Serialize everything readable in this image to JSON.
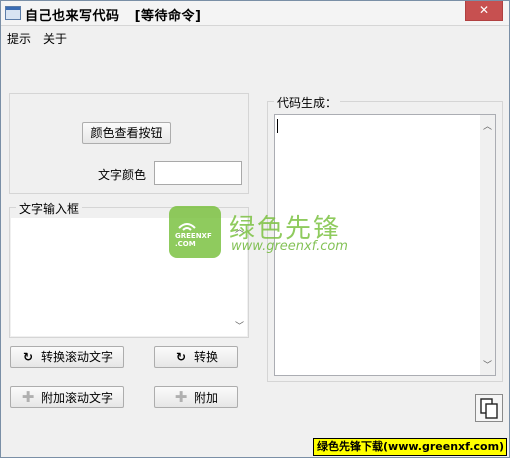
{
  "window": {
    "title": "自己也来写代码   [等待命令]",
    "close_label": "✕"
  },
  "menu": {
    "items": [
      "提示",
      "关于"
    ]
  },
  "color_panel": {
    "view_button": "颜色查看按钮",
    "text_color_label": "文字颜色",
    "text_color_value": ""
  },
  "text_input": {
    "group_title": "文字输入框",
    "value": ""
  },
  "actions": {
    "convert_scroll_label": "转换滚动文字",
    "convert_label": "转换",
    "append_scroll_label": "附加滚动文字",
    "append_label": "附加"
  },
  "code_output": {
    "group_title": "代码生成：",
    "value": ""
  },
  "watermark": {
    "title": "绿色先锋",
    "url": "www.greenxf.com",
    "logo_text": "GREENXF .COM"
  },
  "footer": {
    "badge_text": "绿色先锋下载(www.greenxf.com)"
  },
  "icons": {
    "refresh": "refresh-icon",
    "plus": "plus-icon",
    "copy": "copy-icon"
  }
}
